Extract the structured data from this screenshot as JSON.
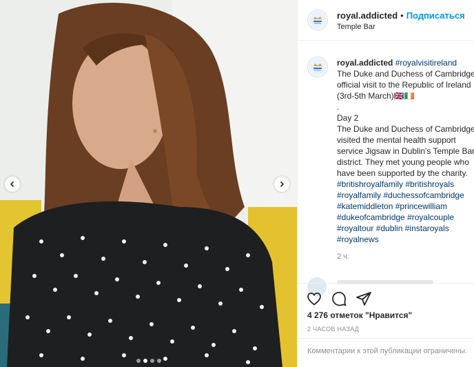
{
  "post": {
    "username": "royal.addicted",
    "separator": "•",
    "follow_label": "Подписаться",
    "location": "Temple Bar"
  },
  "caption": {
    "username": "royal.addicted",
    "first_tag": "#royalvisitireland",
    "lines": [
      "The Duke and Duchess of Cambridge's",
      "official visit to the Republic of Ireland",
      "(3rd-5th March)🇬🇧🇮🇪",
      ".",
      "Day 2",
      "The Duke and Duchess of Cambridge",
      "visited the mental health support",
      "service Jigsaw in Dublin's Temple Bar",
      "district. They met young people who",
      "have been supported by the charity."
    ],
    "hashtag_lines": [
      "#britishroyalfamily #britishroyals",
      "#royalfamily #duchessofcambridge",
      "#katemiddleton #princewilliam",
      "#dukeofcambridge #royalcouple",
      "#royaltour #dublin #instaroyals",
      "#royalnews"
    ],
    "time": "2 ч."
  },
  "engagement": {
    "likes_text": "4 276 отметок \"Нравится\"",
    "time_ago": "2 ЧАСОВ НАЗАД"
  },
  "comment_box": {
    "placeholder": "Комментарии к этой публикации ограничены."
  },
  "carousel": {
    "count": 4,
    "active_index": 1
  },
  "colors": {
    "accent": "#0095f6",
    "hashtag": "#00376b",
    "muted": "#8e8e8e"
  }
}
